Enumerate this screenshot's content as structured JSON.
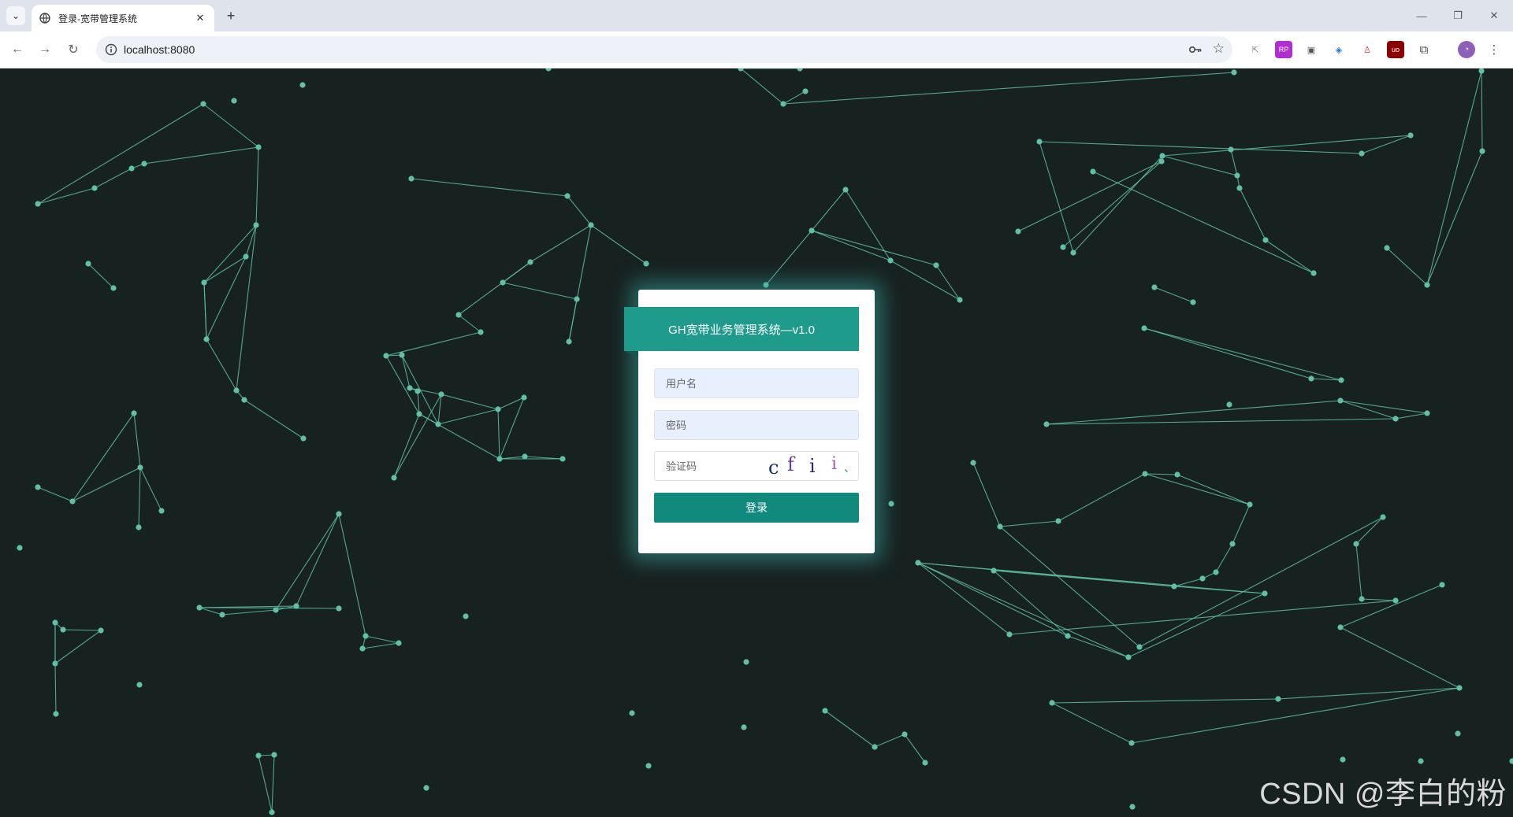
{
  "browser": {
    "tab_title": "登录-宽带管理系统",
    "tab_close": "✕",
    "new_tab": "+",
    "url": "localhost:8080",
    "window_controls": {
      "minimize": "—",
      "restore": "❐",
      "close": "✕"
    }
  },
  "login": {
    "title": "GH宽带业务管理系统—v1.0",
    "username_placeholder": "用户名",
    "password_placeholder": "密码",
    "captcha_placeholder": "验证码",
    "captcha_chars": [
      "c",
      "f",
      "i",
      "i",
      "、"
    ],
    "login_button": "登录"
  },
  "watermark": "CSDN @李白的粉",
  "colors": {
    "background": "#172120",
    "particle": "#5fc0a6",
    "header": "#1f9b8c",
    "button": "#11897c"
  }
}
